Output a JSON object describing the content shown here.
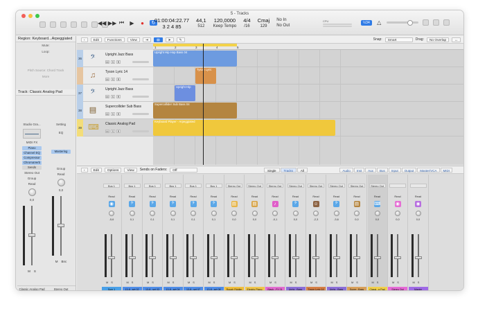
{
  "window": {
    "title": "5 - Tracks"
  },
  "lcd": {
    "position": "01:00:04:22.77",
    "bars": "3  2  4    85",
    "tempo_top": "44,1",
    "tempo_bottom": "512",
    "bpm": "120,0000",
    "tempo_mode": "Keep Tempo",
    "signature": "4/4",
    "division": "/16",
    "key": "Cmaj",
    "key_sub": "129",
    "in": "No In",
    "out": "No Out"
  },
  "cpu_label": "CPU",
  "toolbar_badge": "½34",
  "inspector": {
    "region_header": "Region: Keyboard...Arpeggiated",
    "rows": [
      "Mute:",
      "Loop:",
      "",
      "",
      "Pitch Source: Chord Track",
      "More"
    ],
    "track_header": "Track: Classic Analog Pad",
    "left_strip": {
      "setting": "Studio Gra...",
      "midi_fx": "MIDI FX",
      "inst": "Piano",
      "slots": [
        "Channel EQ",
        "Compressor",
        "ChromaVerb"
      ],
      "sends": "Sends",
      "out": "Stereo Out",
      "group": "Group",
      "read": "Read",
      "vol": "0,0",
      "m": "M",
      "s": "S",
      "name": "Classic Analog Pad"
    },
    "right_strip": {
      "setting": "Setting",
      "eq": "EQ",
      "slot": "Mastering",
      "group": "Group",
      "read": "Read",
      "vol": "0,0",
      "m": "M",
      "bnc": "Bnc",
      "name": "Stereo Out"
    }
  },
  "tracks_toolbar": {
    "edit": "Edit",
    "functions": "Functions",
    "view": "View",
    "snap_label": "Snap:",
    "snap_value": "Smart",
    "drag_label": "Drag:",
    "drag_value": "No Overlap"
  },
  "ruler": {
    "ticks": [
      "1",
      "2",
      "3",
      "4",
      "5"
    ]
  },
  "tracks": [
    {
      "num": "36",
      "name": "Upright Jazz Bass",
      "icon": "𝄢",
      "m": "M",
      "s": "S",
      "r": "R"
    },
    {
      "num": "",
      "name": "Tyson Lyric 14",
      "icon": "♫",
      "m": "M",
      "s": "S",
      "r": "R"
    },
    {
      "num": "37",
      "name": "Upright Jazz Bass",
      "icon": "𝄢",
      "m": "M",
      "s": "S",
      "r": "R"
    },
    {
      "num": "38",
      "name": "Supercollider Sub Bass",
      "icon": "▤",
      "m": "M",
      "s": "S",
      "r": "R"
    },
    {
      "num": "39",
      "name": "Classic Analog Pad",
      "icon": "⌨",
      "m": "M",
      "s": "S",
      "r": "R"
    }
  ],
  "regions": [
    {
      "label": "Upright Hip Hop Bass 04",
      "color": "#6d9be0"
    },
    {
      "label": "Tyson Lyric",
      "color": "#d8914a"
    },
    {
      "label": "Upright Hip",
      "color": "#6d8fe0"
    },
    {
      "label": "Supercollider Sub Bass 04",
      "color": "#b48540"
    },
    {
      "label": "Keyboard Player - Arpeggiated",
      "color": "#f0c83c"
    }
  ],
  "ruler_chords": [
    "C",
    "C7/Db",
    "C",
    "C7/Db"
  ],
  "mixer": {
    "edit": "Edit",
    "options": "Options",
    "view": "View",
    "sends_label": "Sends on Faders:",
    "sends_value": "Off",
    "segments": [
      "Single",
      "Tracks",
      "All"
    ],
    "filters": [
      "Audio",
      "Inst",
      "Aux",
      "Bus",
      "Input",
      "Output",
      "Master/VCA",
      "MIDI"
    ],
    "strips": [
      {
        "io": "Bus 1",
        "chip": "◉",
        "chip_color": "#5aa7e8",
        "val": "-5,6",
        "name": "Sum 1",
        "name_color": "#49a0e8"
      },
      {
        "io": "Bus 1",
        "chip": "𝄢",
        "chip_color": "#5aa7e8",
        "val": "0,1",
        "name": "13-8...set 02",
        "name_color": "#4f8de8"
      },
      {
        "io": "Bus 1",
        "chip": "𝄢",
        "chip_color": "#5aa7e8",
        "val": "0,1",
        "name": "13-8...set 03",
        "name_color": "#4f8de8"
      },
      {
        "io": "Bus 1",
        "chip": "𝄢",
        "chip_color": "#5aa7e8",
        "val": "0,1",
        "name": "13-8...set 04",
        "name_color": "#4f8de8"
      },
      {
        "io": "Bus 1",
        "chip": "𝄢",
        "chip_color": "#5aa7e8",
        "val": "0,1",
        "name": "13-8...set 07",
        "name_color": "#4f8de8"
      },
      {
        "io": "Bus 1",
        "chip": "𝄢",
        "chip_color": "#5aa7e8",
        "val": "0,1",
        "name": "13-8...set 08",
        "name_color": "#4f8de8"
      },
      {
        "io": "Stereo Out",
        "chip": "▤",
        "chip_color": "#e7b549",
        "val": "0,0",
        "name": "Rough Riddim",
        "name_color": "#f1bf3c"
      },
      {
        "io": "Stereo Out",
        "chip": "▤",
        "chip_color": "#d7a449",
        "val": "0,0",
        "name": "Electric Piano",
        "name_color": "#f1c64a"
      },
      {
        "io": "Stereo Out",
        "chip": "♪",
        "chip_color": "#e05ec9",
        "val": "-0,1",
        "name": "Black...FX 01",
        "name_color": "#e36bd0"
      },
      {
        "io": "Stereo Out",
        "chip": "𝄢",
        "chip_color": "#5aa7e8",
        "val": "0,0",
        "name": "Uprig...Bass",
        "name_color": "#8b6ed8"
      },
      {
        "io": "Stereo Out",
        "chip": "☺",
        "chip_color": "#8c6242",
        "val": "-2,3",
        "name": "Tyson Lyric 14",
        "name_color": "#d67f45"
      },
      {
        "io": "Stereo Out",
        "chip": "𝄢",
        "chip_color": "#5aa7e8",
        "val": "-3,6",
        "name": "Uprig...Bass",
        "name_color": "#8b6ed8"
      },
      {
        "io": "Stereo Out",
        "chip": "▤",
        "chip_color": "#b48540",
        "val": "0,0",
        "name": "Super...Bass",
        "name_color": "#d9a05a"
      },
      {
        "io": "Stereo Out",
        "chip": "⌨",
        "chip_color": "#5aa7e8",
        "val": "0,0",
        "name": "Classi...g Pad",
        "name_color": "#f2d04a"
      },
      {
        "io": "",
        "chip": "◉",
        "chip_color": "#e56ed4",
        "val": "0,0",
        "name": "Stereo Out",
        "name_color": "#e66ad6"
      },
      {
        "io": "",
        "chip": "◉",
        "chip_color": "#b86fe0",
        "val": "0,0",
        "name": "Master",
        "name_color": "#9f6ae6"
      }
    ]
  }
}
